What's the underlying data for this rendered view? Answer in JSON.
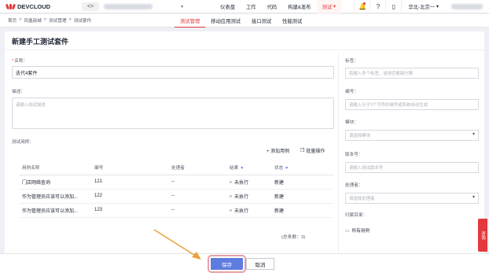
{
  "topbar": {
    "brand": "DEVCLOUD",
    "project_icon": "<>",
    "nav": [
      "仪表盘",
      "工作",
      "代码",
      "构建&发布",
      "测试"
    ],
    "nav_active_chevron": "▾",
    "region": "华北-北京一",
    "region_chevron": "▾"
  },
  "breadcrumb": [
    "首页",
    ">",
    "凤凰商城",
    ">",
    "测试管理",
    ">",
    "测试套件"
  ],
  "subtabs": [
    "测试管理",
    "移动应用测试",
    "接口测试",
    "性能测试"
  ],
  "page_title": "新建手工测试套件",
  "form": {
    "name_label": "名称：",
    "name_required": "*",
    "name_value": "迭代4套件",
    "desc_label": "描述：",
    "desc_placeholder": "请输入测试描述",
    "cases_label": "测试用例：",
    "add_case": "+ 添加用例",
    "batch_op": "批量操作"
  },
  "table": {
    "headers": [
      "用例名称",
      "编号",
      "处理者",
      "结果",
      "状态"
    ],
    "rows": [
      {
        "name": "门店网络查询",
        "id": "121",
        "handler": "--",
        "result": "未执行",
        "status": "新建"
      },
      {
        "name": "作为管理员应该可以添加...",
        "id": "122",
        "handler": "--",
        "result": "未执行",
        "status": "新建"
      },
      {
        "name": "作为管理员应该可以添加...",
        "id": "123",
        "handler": "--",
        "result": "未执行",
        "status": "新建"
      }
    ],
    "total": "(总条数：3)"
  },
  "sidebar_form": {
    "tags_label": "标签：",
    "tags_placeholder": "若输入多个标签，请用空格键分隔",
    "number_label": "编号：",
    "number_placeholder": "请输入分于3个字符的编号或系统自动生成",
    "module_label": "模块：",
    "module_placeholder": "请选择模块",
    "version_label": "版本号：",
    "version_placeholder": "请输入测试版本号",
    "handler_label": "处理者：",
    "handler_placeholder": "请选择处理者",
    "dir_label": "归属目录：",
    "dir_value": "所有用例"
  },
  "buttons": {
    "save": "保存",
    "cancel": "取消"
  },
  "side_tab": "咨询",
  "colors": {
    "accent": "#e4393c",
    "primary": "#5e7ce0",
    "highlight": "#e8a0a8",
    "arrow": "#e8a33c"
  }
}
